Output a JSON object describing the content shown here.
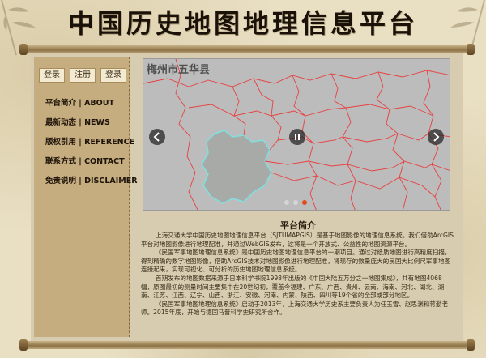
{
  "site_title": "中国历史地图地理信息平台",
  "auth": {
    "login": "登录",
    "register": "注册",
    "signin": "登录"
  },
  "nav": [
    {
      "label": "平台简介 | ABOUT"
    },
    {
      "label": "最新动态 | NEWS"
    },
    {
      "label": "版权引用 | REFERENCE"
    },
    {
      "label": "联系方式 | CONTACT"
    },
    {
      "label": "免责说明 | DISCLAIMER"
    }
  ],
  "carousel": {
    "caption": "梅州市五华县",
    "prev_icon": "chevron-left-icon",
    "next_icon": "chevron-right-icon",
    "pause_icon": "pause-icon",
    "slide_count": 3,
    "active_slide": 3,
    "colors": {
      "boundary": "#e84040",
      "highlight": "#7fe0e0",
      "map_bg": "#bcbcbc"
    }
  },
  "intro": {
    "title": "平台简介",
    "paragraphs": [
      "上海交通大学中国历史地图地理信息平台（SJTUMAPGIS）是基于地图影像的地理信息系统。我们借助ArcGIS平台对地图影像进行地理配准，并通过WebGIS发布，这将是一个开放式、公益性的地图资源平台。",
      "《民国军事地图地理信息系统》是中国历史地图地理信息平台的一期项目。通过对纸质地图进行高精度扫描，得到精确的数字地图影像，借助ArcGIS技术对地图影像进行地理配准，将现存的数量庞大的民国大比例尺军事地图连接起来，实现可视化、可分析的历史地图地理信息系统。",
      "首期发布的地图数据来源于日本科学书院1998年出版的《中国大陆五万分之一地图集成》，共有地图4068幅，原图最初的测量时间主要集中在20世纪初，覆盖今福建、广东、广西、贵州、云南、海南、河北、湖北、湖南、江苏、江西、辽宁、山西、浙江、安徽、河南、内蒙、陕西、四川等19个省的全部或部分地区。",
      "《民国军事地图地理信息系统》启动于2013年，上海交通大学历史系主要负责人为任玉雪、赵思渊和蒋勤老师。2015年底，开始与德国马普科学史研究所合作。"
    ]
  }
}
